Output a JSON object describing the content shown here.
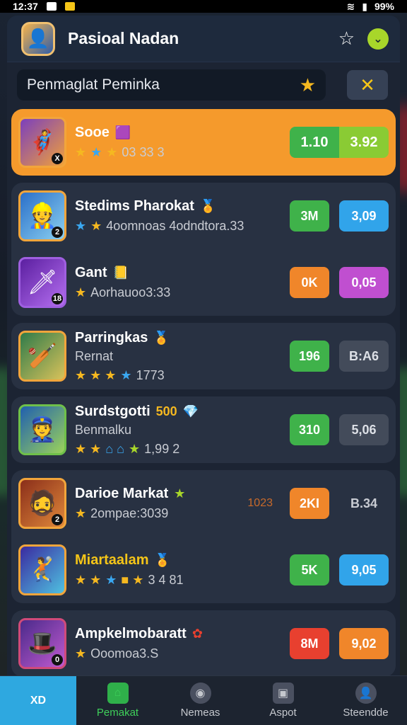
{
  "status": {
    "time": "12:37",
    "battery": "99%"
  },
  "header": {
    "title": "Pasioal Nadan"
  },
  "search": {
    "query": "Penmaglat Peminka"
  },
  "items": [
    {
      "name": "Sooe",
      "stats": "03  33  3",
      "v1": "1.10",
      "v2": "3.92"
    },
    {
      "name": "Stedims Pharokat",
      "stats": "4oomnoas  4odndtora.33",
      "v1": "3M",
      "v2": "3,09"
    },
    {
      "name": "Gant",
      "stats": "Aorhauoo3:33",
      "v1": "0K",
      "v2": "0,05"
    },
    {
      "name": "Parringkas",
      "sub": "Rernat",
      "stats": "1773",
      "v1": "196",
      "v2": "B:A6"
    },
    {
      "name": "Surdstgotti",
      "badge": "500",
      "sub": "Benmalku",
      "stats": "1,99 2",
      "v1": "310",
      "v2": "5,06"
    },
    {
      "name": "Darioe Markat",
      "stats": "2ompae:3039",
      "ghost": "1023",
      "v1": "2KI",
      "v2": "B.34"
    },
    {
      "name": "Miartaalam",
      "stats": "3 4   81",
      "v1": "5K",
      "v2": "9,05"
    },
    {
      "name": "Ampkelmobaratt",
      "stats": "Ooomoa3.S",
      "v1": "8M",
      "v2": "9,02"
    }
  ],
  "tabs": [
    {
      "label": "XD"
    },
    {
      "label": "Pemakat"
    },
    {
      "label": "Nemeas"
    },
    {
      "label": "Aspot"
    },
    {
      "label": "Steendde"
    }
  ],
  "colors": {
    "accent": "#f59a2c",
    "green": "#3fb24a",
    "blue": "#31a4ea"
  }
}
